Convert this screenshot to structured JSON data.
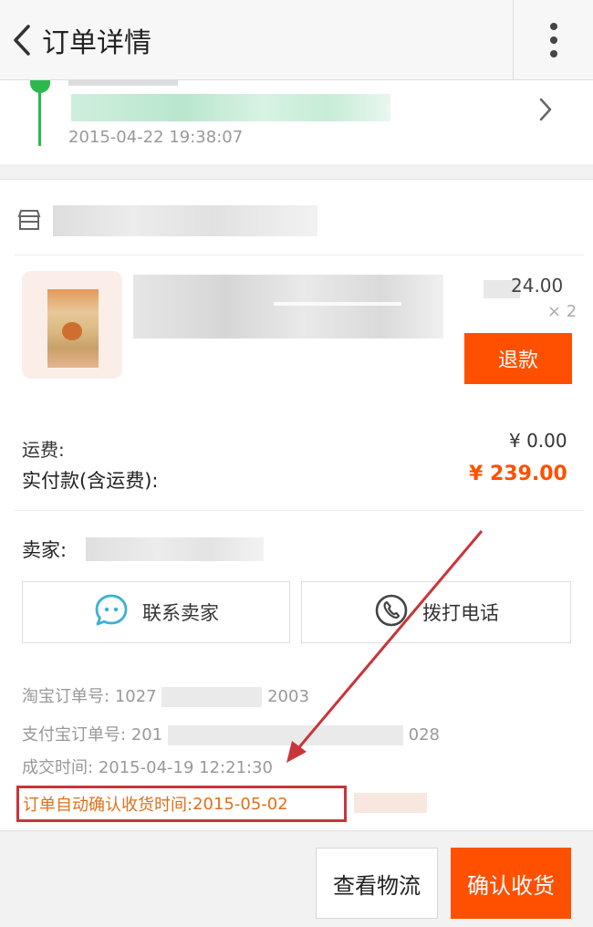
{
  "header": {
    "title": "订单详情"
  },
  "logistics": {
    "time": "2015-04-22 19:38:07"
  },
  "goods": {
    "price_suffix": "24.00",
    "qty": "× 2",
    "refund_label": "退款"
  },
  "fees": {
    "shipping_label": "运费:",
    "shipping_value": "¥ 0.00",
    "paid_label": "实付款(含运费):",
    "paid_value": "¥ 239.00"
  },
  "seller": {
    "label": "卖家:",
    "contact_label": "联系卖家",
    "call_label": "拨打电话"
  },
  "order_info": {
    "taobao_label": "淘宝订单号:",
    "taobao_prefix": "1027",
    "taobao_suffix": "2003",
    "alipay_label": "支付宝订单号:",
    "alipay_prefix": "201",
    "alipay_suffix": "028",
    "deal_time_label": "成交时间:",
    "deal_time_value": "2015-04-19 12:21:30",
    "auto_confirm_label": "订单自动确认收货时间:",
    "auto_confirm_value": "2015-05-02"
  },
  "bottom": {
    "view_logistics_label": "查看物流",
    "confirm_label": "确认收货"
  },
  "colors": {
    "accent": "#ff5000",
    "timeline": "#2db84d",
    "annotation": "#c8353a",
    "auto_confirm_text": "#e0701c"
  },
  "icons": {
    "back": "chevron-left-icon",
    "menu": "more-vertical-icon",
    "logistics_arrow": "chevron-right-icon",
    "shop": "shop-icon",
    "contact": "chat-bubble-icon",
    "call": "phone-icon"
  }
}
